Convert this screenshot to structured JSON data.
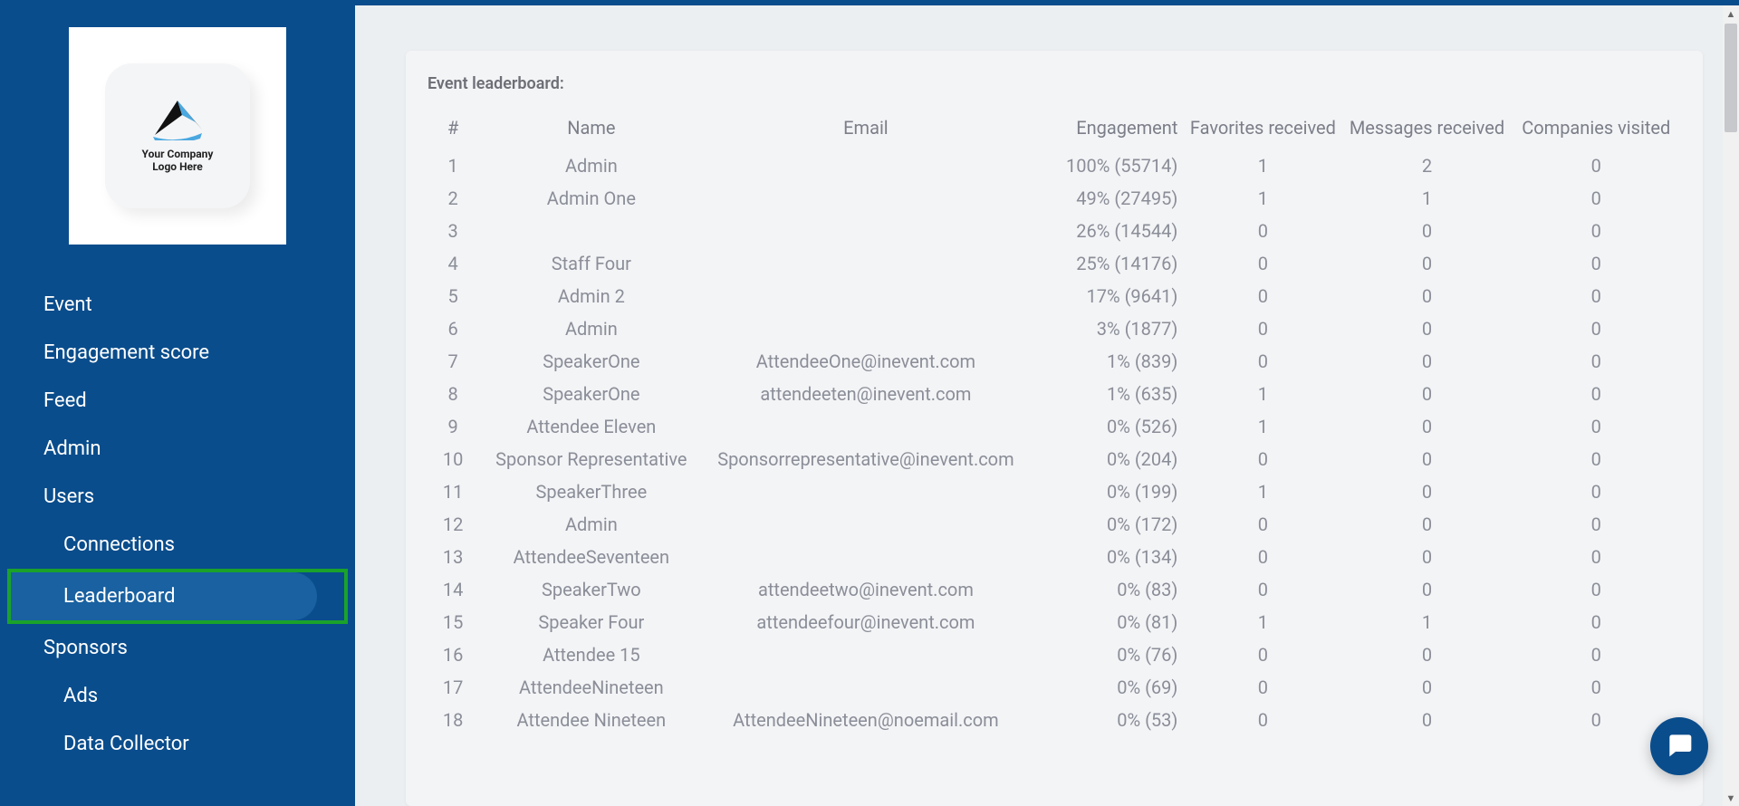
{
  "logo": {
    "line1": "Your Company",
    "line2": "Logo Here"
  },
  "sidebar": {
    "items": [
      {
        "label": "Event",
        "sub": false
      },
      {
        "label": "Engagement score",
        "sub": false
      },
      {
        "label": "Feed",
        "sub": false
      },
      {
        "label": "Admin",
        "sub": false
      },
      {
        "label": "Users",
        "sub": false
      },
      {
        "label": "Connections",
        "sub": true
      },
      {
        "label": "Leaderboard",
        "sub": true,
        "active": true
      },
      {
        "label": "Sponsors",
        "sub": false
      },
      {
        "label": "Ads",
        "sub": true
      },
      {
        "label": "Data Collector",
        "sub": true
      }
    ]
  },
  "card": {
    "title": "Event leaderboard:"
  },
  "table": {
    "headers": [
      "#",
      "Name",
      "Email",
      "Engagement",
      "Favorites received",
      "Messages received",
      "Companies visited"
    ],
    "rows": [
      {
        "rank": "1",
        "name": "Admin",
        "email": "",
        "engagement": "100% (55714)",
        "favorites": "1",
        "messages": "2",
        "companies": "0"
      },
      {
        "rank": "2",
        "name": "Admin One",
        "email": "",
        "engagement": "49% (27495)",
        "favorites": "1",
        "messages": "1",
        "companies": "0"
      },
      {
        "rank": "3",
        "name": "",
        "email": "",
        "engagement": "26% (14544)",
        "favorites": "0",
        "messages": "0",
        "companies": "0"
      },
      {
        "rank": "4",
        "name": "Staff Four",
        "email": "",
        "engagement": "25% (14176)",
        "favorites": "0",
        "messages": "0",
        "companies": "0"
      },
      {
        "rank": "5",
        "name": "Admin 2",
        "email": "",
        "engagement": "17% (9641)",
        "favorites": "0",
        "messages": "0",
        "companies": "0"
      },
      {
        "rank": "6",
        "name": "Admin",
        "email": "",
        "engagement": "3% (1877)",
        "favorites": "0",
        "messages": "0",
        "companies": "0"
      },
      {
        "rank": "7",
        "name": "SpeakerOne",
        "email": "AttendeeOne@inevent.com",
        "engagement": "1% (839)",
        "favorites": "0",
        "messages": "0",
        "companies": "0"
      },
      {
        "rank": "8",
        "name": "SpeakerOne",
        "email": "attendeeten@inevent.com",
        "engagement": "1% (635)",
        "favorites": "1",
        "messages": "0",
        "companies": "0"
      },
      {
        "rank": "9",
        "name": "Attendee Eleven",
        "email": "",
        "engagement": "0% (526)",
        "favorites": "1",
        "messages": "0",
        "companies": "0"
      },
      {
        "rank": "10",
        "name": "Sponsor Representative",
        "email": "Sponsorrepresentative@inevent.com",
        "engagement": "0% (204)",
        "favorites": "0",
        "messages": "0",
        "companies": "0"
      },
      {
        "rank": "11",
        "name": "SpeakerThree",
        "email": "",
        "engagement": "0% (199)",
        "favorites": "1",
        "messages": "0",
        "companies": "0"
      },
      {
        "rank": "12",
        "name": "Admin",
        "email": "",
        "engagement": "0% (172)",
        "favorites": "0",
        "messages": "0",
        "companies": "0"
      },
      {
        "rank": "13",
        "name": "AttendeeSeventeen",
        "email": "",
        "engagement": "0% (134)",
        "favorites": "0",
        "messages": "0",
        "companies": "0"
      },
      {
        "rank": "14",
        "name": "SpeakerTwo",
        "email": "attendeetwo@inevent.com",
        "engagement": "0% (83)",
        "favorites": "0",
        "messages": "0",
        "companies": "0"
      },
      {
        "rank": "15",
        "name": "Speaker Four",
        "email": "attendeefour@inevent.com",
        "engagement": "0% (81)",
        "favorites": "1",
        "messages": "1",
        "companies": "0"
      },
      {
        "rank": "16",
        "name": "Attendee 15",
        "email": "",
        "engagement": "0% (76)",
        "favorites": "0",
        "messages": "0",
        "companies": "0"
      },
      {
        "rank": "17",
        "name": "AttendeeNineteen",
        "email": "",
        "engagement": "0% (69)",
        "favorites": "0",
        "messages": "0",
        "companies": "0"
      },
      {
        "rank": "18",
        "name": "Attendee Nineteen",
        "email": "AttendeeNineteen@noemail.com",
        "engagement": "0% (53)",
        "favorites": "0",
        "messages": "0",
        "companies": "0"
      }
    ]
  }
}
